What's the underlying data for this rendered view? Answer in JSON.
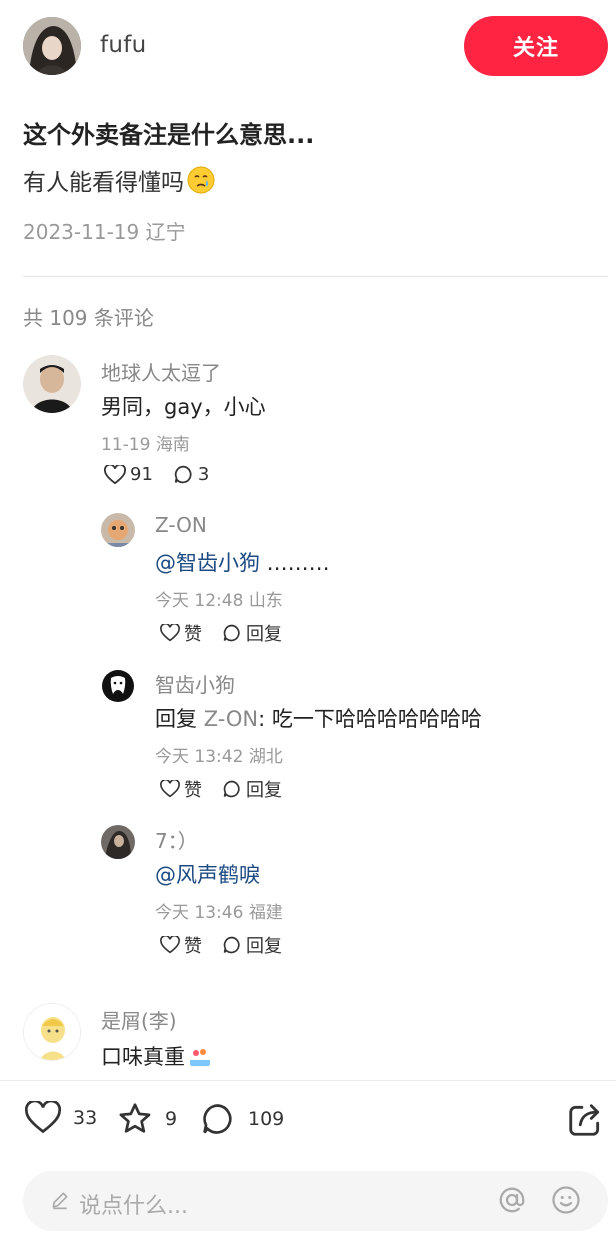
{
  "author": {
    "name": "fufu",
    "follow_label": "关注"
  },
  "post": {
    "title": "这个外卖备注是什么意思...",
    "body": "有人能看得懂吗",
    "date": "2023-11-19",
    "location": "辽宁"
  },
  "comments_header": {
    "text": "共 109 条评论"
  },
  "comments": [
    {
      "name": "地球人太逗了",
      "text": "男同，gay，小心",
      "date": "11-19",
      "location": "海南",
      "likes": "91",
      "replies": "3",
      "sub": [
        {
          "name": "Z-ON",
          "mention": "@智齿小狗",
          "text": " ………",
          "date": "今天 12:48",
          "location": "山东",
          "like_label": "赞",
          "reply_label": "回复"
        },
        {
          "name": "智齿小狗",
          "reply_prefix": "回复 ",
          "reply_to": "Z-ON",
          "text": ": 吃一下哈哈哈哈哈哈哈",
          "date": "今天 13:42",
          "location": "湖北",
          "like_label": "赞",
          "reply_label": "回复"
        },
        {
          "name": "7：）",
          "mention": "@风声鹤唳",
          "text": "",
          "date": "今天 13:46",
          "location": "福建",
          "like_label": "赞",
          "reply_label": "回复"
        }
      ]
    },
    {
      "name": "是屑(李)",
      "text": "口味真重"
    }
  ],
  "bottom": {
    "likes": "33",
    "stars": "9",
    "comments": "109",
    "input_placeholder": "说点什么..."
  },
  "colors": {
    "accent": "#ff2442",
    "mention": "#1c4a82"
  }
}
